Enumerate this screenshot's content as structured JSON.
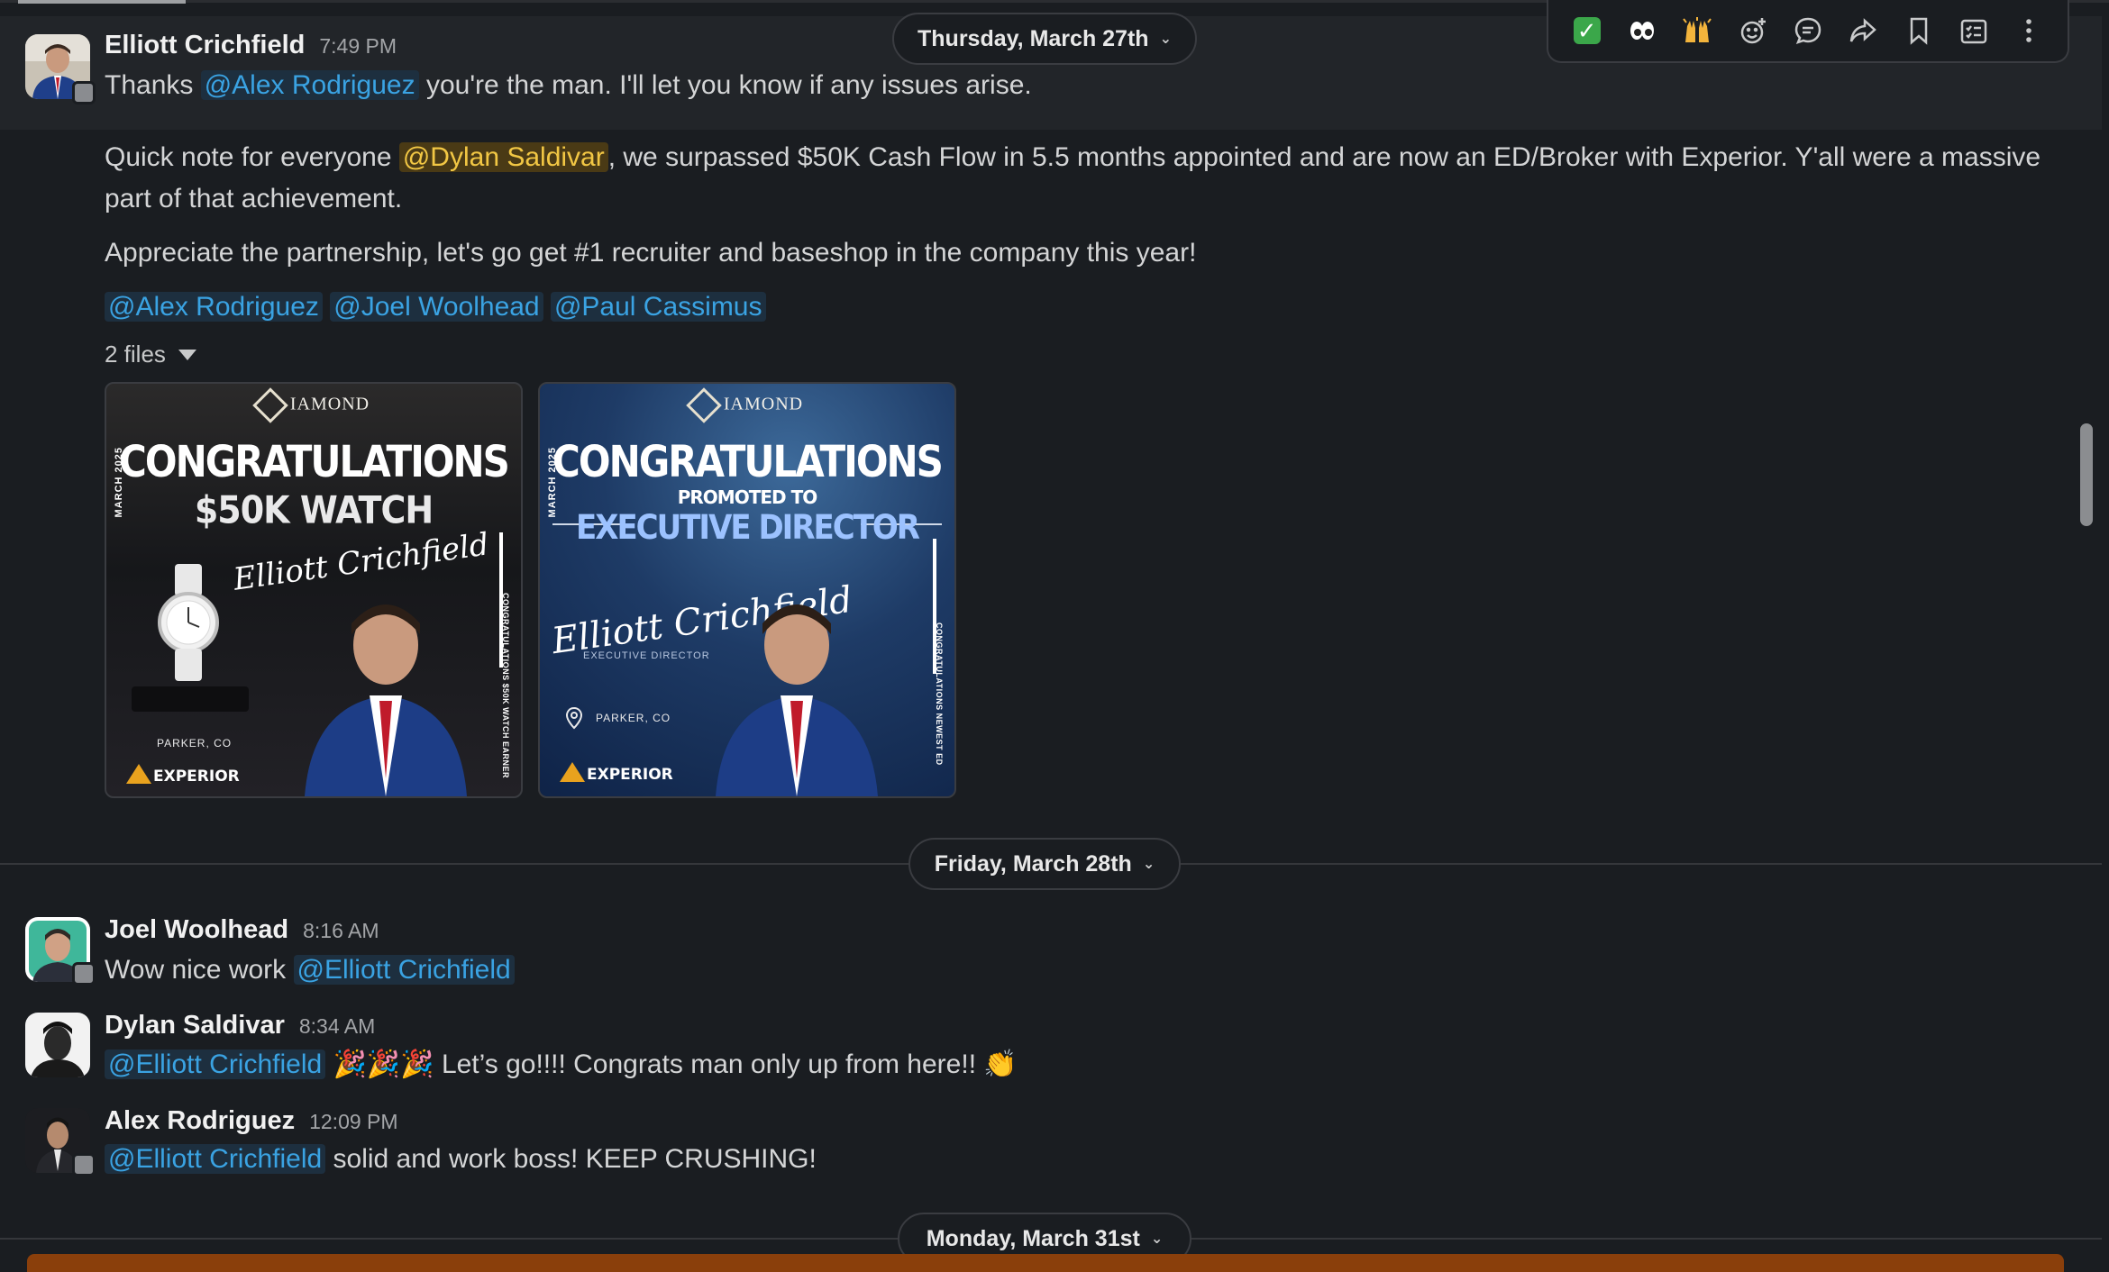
{
  "colors": {
    "background": "#1a1d21",
    "mention_blue": "#3aa3e3",
    "self_mention_yellow": "#f2c744",
    "bottom_banner": "#8a3f0b"
  },
  "toolbar": {
    "items": [
      {
        "icon": "white-check-mark-emoji",
        "glyph": "✓"
      },
      {
        "icon": "eyes-emoji",
        "glyph": "👀"
      },
      {
        "icon": "raised-hands-emoji",
        "glyph": "🙌"
      },
      {
        "icon": "add-reaction-icon"
      },
      {
        "icon": "reply-in-thread-icon"
      },
      {
        "icon": "forward-icon"
      },
      {
        "icon": "save-bookmark-icon"
      },
      {
        "icon": "add-to-list-icon"
      },
      {
        "icon": "more-actions-icon"
      }
    ]
  },
  "dividers": {
    "thursday": "Thursday, March 27th",
    "friday": "Friday, March 28th",
    "monday": "Monday, March 31st"
  },
  "messages": {
    "elliott_first": {
      "author": "Elliott Crichfield",
      "time": "7:49 PM",
      "text_before": "Thanks ",
      "mention": "@Alex Rodriguez",
      "text_after": " you're the man. I'll let you know if any issues arise."
    },
    "elliott_second": {
      "p1_before": "Quick note for everyone ",
      "p1_mention": "@Dylan Saldivar",
      "p1_after": ", we surpassed $50K Cash Flow in 5.5 months appointed and are now an ED/Broker with Experior. Y'all were a massive part of that achievement.",
      "p2": "Appreciate the partnership, let's go get #1 recruiter and baseshop in the company this year!",
      "mentions": [
        "@Alex Rodriguez",
        "@Joel Woolhead",
        "@Paul Cassimus"
      ],
      "files_label": "2 files"
    },
    "joel": {
      "author": "Joel Woolhead",
      "time": "8:16 AM",
      "text": "Wow nice work ",
      "mention": "@Elliott Crichfield"
    },
    "dylan": {
      "author": "Dylan Saldivar",
      "time": "8:34 AM",
      "mention": "@Elliott Crichfield",
      "emojis": "🎉🎉🎉",
      "text": "Let’s go!!!! Congrats man only up from here!!",
      "clap": "👏"
    },
    "alex": {
      "author": "Alex Rodriguez",
      "time": "12:09 PM",
      "mention": "@Elliott Crichfield",
      "text": " solid and work boss! KEEP CRUSHING!"
    }
  },
  "cards": {
    "card1": {
      "logo": "IAMOND",
      "side": "MARCH 2025",
      "title": "CONGRATULATIONS",
      "subtitle": "$50K WATCH",
      "signature": "Elliott Crichfield",
      "location": "PARKER, CO",
      "brand": "EXPERIOR",
      "side_right": "CONGRATULATIONS $50K WATCH EARNER"
    },
    "card2": {
      "logo": "IAMOND",
      "side": "MARCH 2025",
      "title": "CONGRATULATIONS",
      "promoted": "PROMOTED TO",
      "subtitle": "EXECUTIVE DIRECTOR",
      "signature": "Elliott Crichfield",
      "role": "EXECUTIVE DIRECTOR",
      "location": "PARKER, CO",
      "brand": "EXPERIOR",
      "side_right": "CONGRATULATIONS NEWEST ED"
    }
  }
}
